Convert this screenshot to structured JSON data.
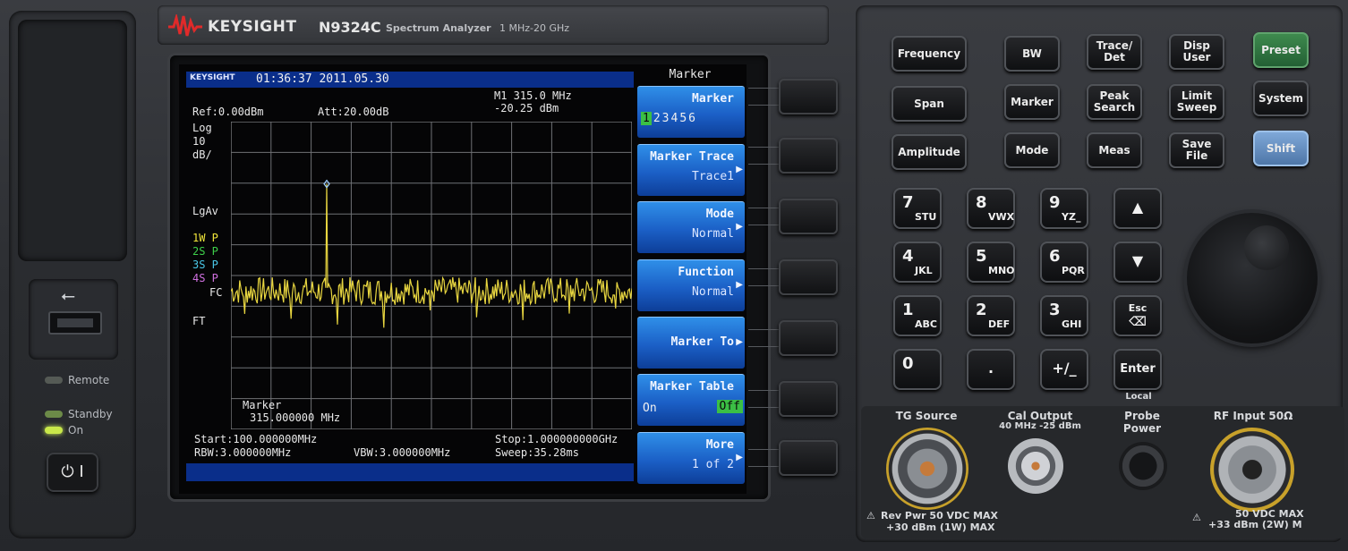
{
  "header": {
    "brand": "KEYSIGHT",
    "model": "N9324C",
    "description": "Spectrum Analyzer",
    "range": "1 MHz-20 GHz"
  },
  "left_panel": {
    "usb_icon": "usb-icon",
    "remote_label": "Remote",
    "standby_label": "Standby",
    "on_label": "On",
    "power_symbol": "⏻ I"
  },
  "screen": {
    "logo": "KEYSIGHT",
    "datetime": "01:36:37 2011.05.30",
    "ref": "Ref:0.00dBm",
    "att": "Att:20.00dB",
    "marker_readout_freq": "M1 315.0 MHz",
    "marker_readout_amp": "-20.25 dBm",
    "scale_type": "Log",
    "scale_value": "10",
    "scale_unit": "dB/",
    "avg": "LgAv",
    "traces": [
      "1W P",
      "2S P",
      "3S P",
      "4S P"
    ],
    "trace_colors": [
      "#f1e63a",
      "#3ed04a",
      "#4ac8e8",
      "#d070e0"
    ],
    "fc": "FC",
    "ft": "FT",
    "marker_label": "Marker",
    "marker_value": "315.000000 MHz",
    "start": "Start:100.000000MHz",
    "stop": "Stop:1.000000000GHz",
    "rbw": "RBW:3.000000MHz",
    "vbw": "VBW:3.000000MHz",
    "sweep": "Sweep:35.28ms",
    "marker_freq_mhz": 315.0,
    "marker_amp_dbm": -20.25
  },
  "softkeys": {
    "menu_title": "Marker",
    "marker": {
      "label": "Marker",
      "options": [
        "1",
        "2",
        "3",
        "4",
        "5",
        "6"
      ],
      "selected": "1"
    },
    "marker_trace": {
      "label": "Marker Trace",
      "value": "Trace1"
    },
    "mode": {
      "label": "Mode",
      "value": "Normal"
    },
    "function": {
      "label": "Function",
      "value": "Normal"
    },
    "marker_to": {
      "label": "Marker To"
    },
    "marker_table": {
      "label": "Marker Table",
      "on": "On",
      "off": "Off"
    },
    "more": {
      "label": "More",
      "value": "1 of 2"
    }
  },
  "keys": {
    "frequency": "Frequency",
    "span": "Span",
    "amplitude": "Amplitude",
    "bw": "BW",
    "marker": "Marker",
    "mode": "Mode",
    "trace_det": "Trace/\nDet",
    "peak_search": "Peak\nSearch",
    "meas": "Meas",
    "disp_user": "Disp\nUser",
    "limit_sweep": "Limit\nSweep",
    "save_file": "Save\nFile",
    "preset": "Preset",
    "system": "System",
    "shift": "Shift",
    "enter": "Enter",
    "local": "Local",
    "esc": "Esc"
  },
  "numpad": [
    {
      "d": "7",
      "l": "STU"
    },
    {
      "d": "8",
      "l": "VWX"
    },
    {
      "d": "9",
      "l": "YZ_"
    },
    {
      "d": "4",
      "l": "JKL"
    },
    {
      "d": "5",
      "l": "MNO"
    },
    {
      "d": "6",
      "l": "PQR"
    },
    {
      "d": "1",
      "l": "ABC"
    },
    {
      "d": "2",
      "l": "DEF"
    },
    {
      "d": "3",
      "l": "GHI"
    },
    {
      "d": "0",
      "l": ""
    },
    {
      "d": ".",
      "l": ""
    },
    {
      "d": "+/_",
      "l": ""
    }
  ],
  "connectors": {
    "tg_source": "TG Source",
    "cal_output": "Cal Output",
    "cal_output_spec": "40 MHz -25 dBm",
    "probe_power": "Probe\nPower",
    "rf_input": "RF Input 50Ω",
    "tg_warning_1": "Rev Pwr 50 VDC MAX",
    "tg_warning_2": "+30 dBm (1W) MAX",
    "rf_warning_1": "50 VDC MAX",
    "rf_warning_2": "+33 dBm (2W) M"
  }
}
